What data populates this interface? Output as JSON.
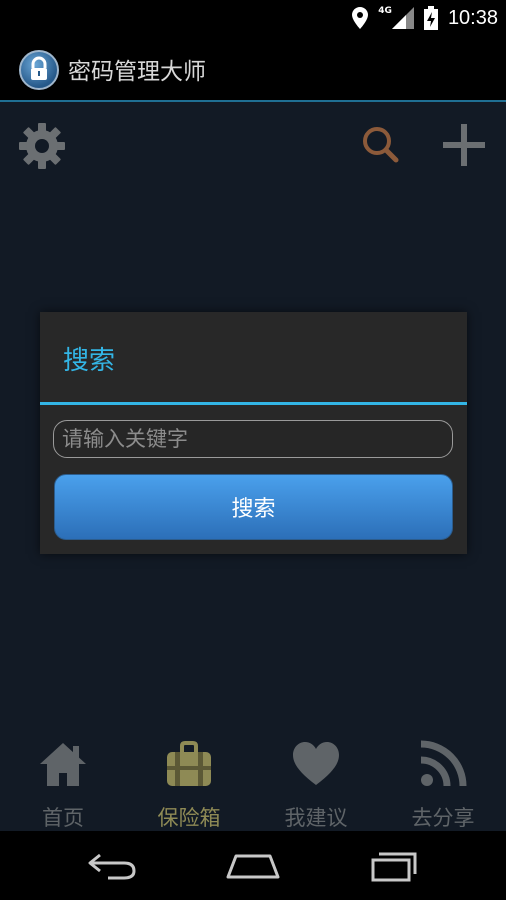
{
  "status": {
    "time": "10:38",
    "network": "4G"
  },
  "app": {
    "title": "密码管理大师"
  },
  "toolbar": {
    "settings_icon": "gear-icon",
    "search_icon": "search-icon",
    "add_icon": "plus-icon"
  },
  "dialog": {
    "title": "搜索",
    "input_placeholder": "请输入关键字",
    "input_value": "",
    "button_label": "搜索"
  },
  "tabs": [
    {
      "label": "首页",
      "icon": "home-icon",
      "active": false
    },
    {
      "label": "保险箱",
      "icon": "safe-icon",
      "active": true
    },
    {
      "label": "我建议",
      "icon": "heart-icon",
      "active": false
    },
    {
      "label": "去分享",
      "icon": "rss-icon",
      "active": false
    }
  ],
  "colors": {
    "accent": "#33b5e5",
    "tab_active": "#8e8a55",
    "tab_inactive": "#5f6468"
  }
}
